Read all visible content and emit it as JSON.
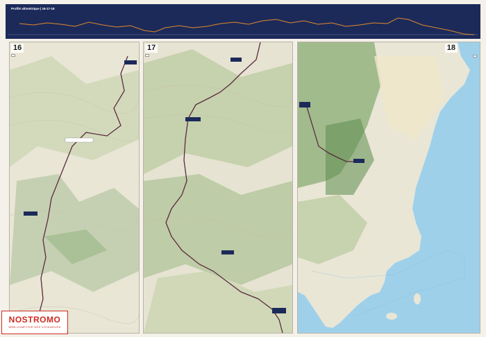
{
  "header": {
    "title": "Profilé altimétrique | 16-17-18",
    "subtitle": "",
    "profile_color": "#e08a2a",
    "bg_color": "#1c2a5a"
  },
  "maps": [
    {
      "number": "16",
      "legend": [
        "",
        "",
        "",
        "",
        ""
      ]
    },
    {
      "number": "17",
      "legend": [
        "",
        "",
        "",
        ""
      ]
    },
    {
      "number": "18",
      "legend": [
        ""
      ]
    }
  ],
  "logo": {
    "name": "NOSTROMO",
    "tagline": "WEB-COMPTOIR DES VOYAGEURS"
  },
  "colors": {
    "terrain_light": "#e9e6d6",
    "terrain_green": "#8fb07a",
    "sea": "#9fd0ea",
    "trail": "#5b2a3e",
    "brand_red": "#cc2a1f"
  }
}
